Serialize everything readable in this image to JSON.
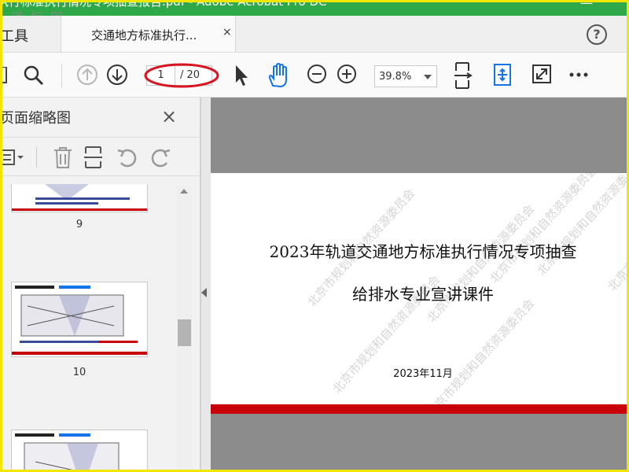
{
  "window": {
    "title": "执行标准执行情况专项抽查报告.pdf - Adobe Acrobat Pro DC",
    "minimize_glyph": "—",
    "logo_text": "道 标 网"
  },
  "tabs": {
    "tools_label": "工具",
    "doc_tab_label": "交通地方标准执行...",
    "doc_tab_close": "×",
    "help_glyph": "?"
  },
  "toolbar": {
    "current_page": "1",
    "total_pages": "/ 20",
    "zoom": "39.8%",
    "icons": [
      "save-icon",
      "search-icon",
      "page-up-icon",
      "page-down-icon",
      "select-cursor-icon",
      "hand-icon",
      "zoom-out-icon",
      "zoom-in-icon",
      "fit-page-icon",
      "scroll-mode-icon",
      "fullscreen-icon",
      "more-icon"
    ]
  },
  "left_panel": {
    "title": "页面缩略图",
    "close_glyph": "×",
    "tool_icons": [
      "thumbnail-options-icon",
      "delete-icon",
      "insert-page-icon",
      "rotate-left-icon",
      "rotate-right-icon"
    ],
    "thumbnails": [
      {
        "number": "9"
      },
      {
        "number": "10"
      },
      {
        "number": ""
      }
    ]
  },
  "document": {
    "title_line1": "2023年轨道交通地方标准执行情况专项抽查",
    "title_line2": "给排水专业宣讲课件",
    "date": "2023年11月",
    "watermark": "北京市规划和自然资源委员会"
  },
  "colors": {
    "titlebar": "#2fa84a",
    "accent_red": "#c8000a",
    "highlight_yellow": "#f2e600",
    "acrobat_blue": "#1473e6"
  }
}
